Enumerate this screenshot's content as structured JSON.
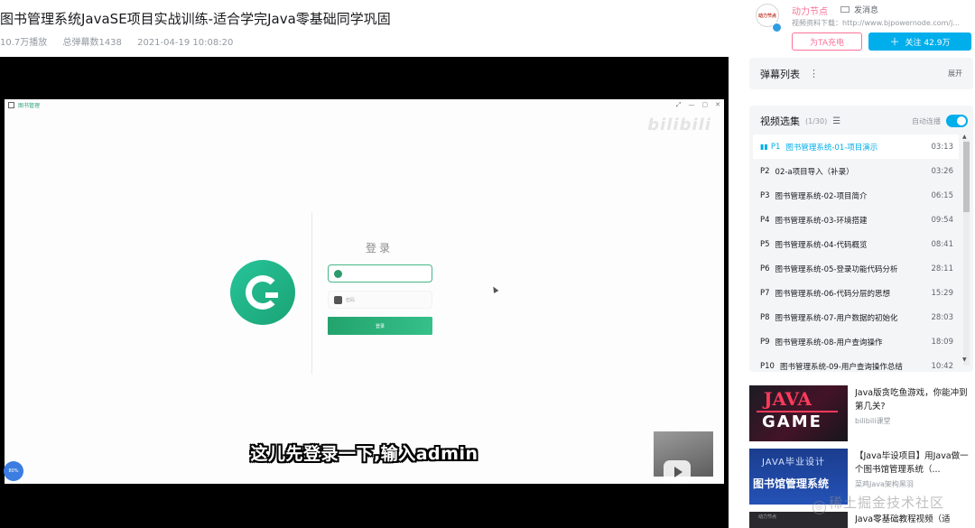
{
  "video": {
    "title": "图书管理系统JavaSE项目实战训练-适合学完Java零基础同学巩固",
    "views": "10.7万播放",
    "danmaku_count": "总弹幕数1438",
    "date": "2021-04-19 10:08:20"
  },
  "player": {
    "window_title": "图书管理",
    "watermark": "bilibili",
    "login_title": "登录",
    "password_placeholder": "密码",
    "login_button": "登录",
    "subtitle": "这儿先登录一下,输入admin",
    "float_ball": "80%"
  },
  "uploader": {
    "avatar_text": "动力节点",
    "name": "动力节点",
    "message_label": "发消息",
    "description": "视频资料下载：http://www.bjpowernode.com/j...",
    "charge_label": "为TA充电",
    "follow_label": "关注 42.9万"
  },
  "danmaku_panel": {
    "title": "弹幕列表",
    "expand_label": "展开"
  },
  "playlist": {
    "title": "视频选集",
    "count": "(1/30)",
    "autoplay_label": "自动连播",
    "items": [
      {
        "num": "P1",
        "name": "图书管理系统-01-项目演示",
        "duration": "03:13",
        "active": true
      },
      {
        "num": "P2",
        "name": "02-a项目导入（补录）",
        "duration": "03:26"
      },
      {
        "num": "P3",
        "name": "图书管理系统-02-项目简介",
        "duration": "06:15"
      },
      {
        "num": "P4",
        "name": "图书管理系统-03-环境搭建",
        "duration": "09:54"
      },
      {
        "num": "P5",
        "name": "图书管理系统-04-代码概览",
        "duration": "08:41"
      },
      {
        "num": "P6",
        "name": "图书管理系统-05-登录功能代码分析",
        "duration": "28:11"
      },
      {
        "num": "P7",
        "name": "图书管理系统-06-代码分层的思想",
        "duration": "15:29"
      },
      {
        "num": "P8",
        "name": "图书管理系统-07-用户数据的初始化",
        "duration": "28:03"
      },
      {
        "num": "P9",
        "name": "图书管理系统-08-用户查询操作",
        "duration": "18:09"
      },
      {
        "num": "P10",
        "name": "图书管理系统-09-用户查询操作总结",
        "duration": "10:42"
      }
    ]
  },
  "recommendations": [
    {
      "title": "Java版贪吃鱼游戏，你能冲到第几关?",
      "uploader": "bilibili课堂",
      "thumb_line1": "JAVA",
      "thumb_line2": "GAME"
    },
    {
      "title": "【Java毕设项目】用Java做一个图书馆管理系统（...",
      "uploader": "菜鸡Java架构黑羽",
      "thumb_line1": "JAVA毕业设计",
      "thumb_line2": "图书馆管理系统"
    },
    {
      "title": "Java零基础教程视频（适",
      "uploader": "",
      "thumb_line1": "动力节点"
    }
  ],
  "site_watermark": "稀土掘金技术社区",
  "colors": {
    "accent": "#00aeec",
    "pink": "#fb7299",
    "login_green": "#23a36d"
  }
}
